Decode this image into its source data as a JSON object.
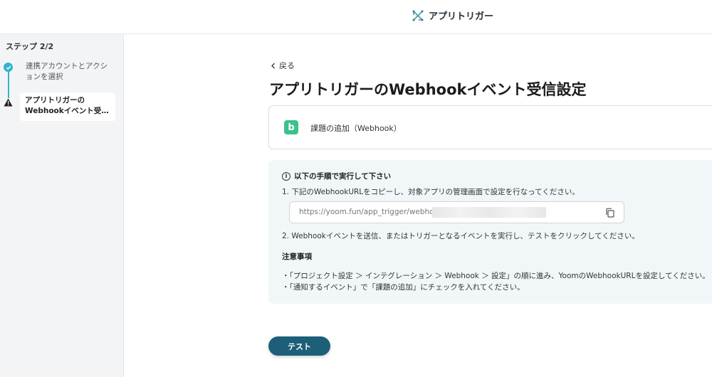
{
  "header": {
    "brand_label": "アプリトリガー",
    "brand_icon": "network-nodes-icon"
  },
  "sidebar": {
    "step_count": "ステップ 2/2",
    "steps": [
      {
        "label": "連携アカウントとアクションを選択",
        "status": "complete"
      },
      {
        "label_line1": "アプリトリガーの",
        "label_line2": "Webhookイベント受信...",
        "status": "warning"
      }
    ]
  },
  "main": {
    "back_label": "戻る",
    "title": "アプリトリガーのWebhookイベント受信設定",
    "trigger": {
      "icon_letter": "b",
      "label": "課題の追加（Webhook）"
    },
    "info": {
      "heading": "以下の手順で実行して下さい",
      "step1": "1. 下記のWebhookURLをコピーし、対象アプリの管理画面で設定を行なってください。",
      "url": "https://yoom.fun/app_trigger/webhooks",
      "step2": "2. Webhookイベントを送信、またはトリガーとなるイベントを実行し、テストをクリックしてください。",
      "notes_heading": "注意事項",
      "notes": [
        "・「プロジェクト設定 ＞ インテグレーション ＞ Webhook ＞ 設定」の順に進み、YoomのWebhookURLを設定してください。",
        "・「通知するイベント」で「課題の追加」にチェックを入れてください。"
      ]
    },
    "test_button": "テスト"
  },
  "colors": {
    "accent": "#34b3c7",
    "button": "#1d5f78",
    "trigger_icon": "#3cc18a",
    "info_bg": "#f1f7f8"
  }
}
